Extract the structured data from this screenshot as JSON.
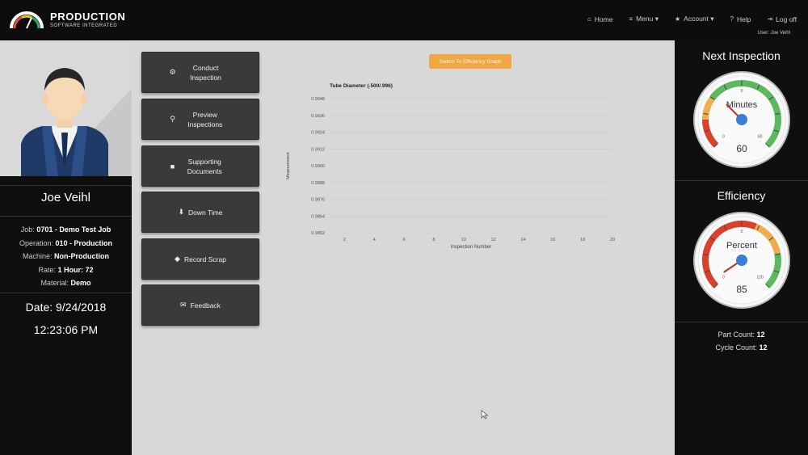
{
  "brand": {
    "name": "PRODUCTION",
    "tagline": "SOFTWARE INTEGRATED"
  },
  "nav": {
    "items": [
      {
        "icon": "home-icon",
        "glyph": "⌂",
        "label": "Home"
      },
      {
        "icon": "list-icon",
        "glyph": "≡",
        "label": "Menu ▾"
      },
      {
        "icon": "star-icon",
        "glyph": "★",
        "label": "Account ▾"
      },
      {
        "icon": "help-icon",
        "glyph": "?",
        "label": "Help"
      },
      {
        "icon": "logout-icon",
        "glyph": "⇥",
        "label": "Log off"
      }
    ],
    "user": "User: Joe Veihl"
  },
  "operator": {
    "name": "Joe Veihl",
    "details": [
      {
        "label": "Job:",
        "value": "0701 - Demo Test Job"
      },
      {
        "label": "Operation:",
        "value": "010 - Production"
      },
      {
        "label": "Machine:",
        "value": "Non-Production"
      },
      {
        "label": "Rate:",
        "value": "1 Hour: 72"
      },
      {
        "label": "Material:",
        "value": "Demo"
      }
    ],
    "date": "Date: 9/24/2018",
    "time": "12:23:06 PM"
  },
  "actions": [
    {
      "icon": "settings-icon",
      "glyph": "⚙",
      "label": "Conduct Inspection"
    },
    {
      "icon": "search-icon",
      "glyph": "⚲",
      "label": "Preview Inspections"
    },
    {
      "icon": "document-icon",
      "glyph": "■",
      "label": "Supporting Documents"
    },
    {
      "icon": "arrow-down-icon",
      "glyph": "⬇",
      "label": "Down Time"
    },
    {
      "icon": "tag-icon",
      "glyph": "◆",
      "label": "Record Scrap"
    },
    {
      "icon": "feedback-icon",
      "glyph": "✉",
      "label": "Feedback"
    }
  ],
  "chart_toggle_label": "Switch To Efficiency Graph",
  "chart_data": {
    "type": "line",
    "title": "Tube Diameter (.500/.996)",
    "xlabel": "Inspection Number",
    "ylabel": "Measurement",
    "x_ticks": [
      2,
      4,
      6,
      8,
      10,
      12,
      14,
      16,
      18,
      20
    ],
    "y_ticks": [
      0.9852,
      0.9864,
      0.9876,
      0.9888,
      0.99,
      0.9912,
      0.9924,
      0.9936,
      0.9948
    ],
    "xlim": [
      1,
      20
    ],
    "ylim": [
      0.9852,
      0.9948
    ],
    "grid": true,
    "series": []
  },
  "next_inspection": {
    "title": "Next Inspection",
    "unit": "Minutes",
    "value": 60,
    "min": 0,
    "max": 60,
    "min_label": "0",
    "max_label": "60",
    "top_label": "0"
  },
  "efficiency": {
    "title": "Efficiency",
    "unit": "Percent",
    "value": 85,
    "min": 0,
    "max": 120,
    "min_label": "0",
    "max_label": "120",
    "top_label": "0"
  },
  "counts": [
    {
      "label": "Part Count:",
      "value": "12"
    },
    {
      "label": "Cycle Count:",
      "value": "12"
    }
  ],
  "colors": {
    "accent_orange": "#f0a641",
    "gauge_green": "#5cb85c",
    "gauge_red": "#d9412b",
    "gauge_yellow": "#f0ad4e",
    "needle_blue": "#3b7dd8"
  }
}
